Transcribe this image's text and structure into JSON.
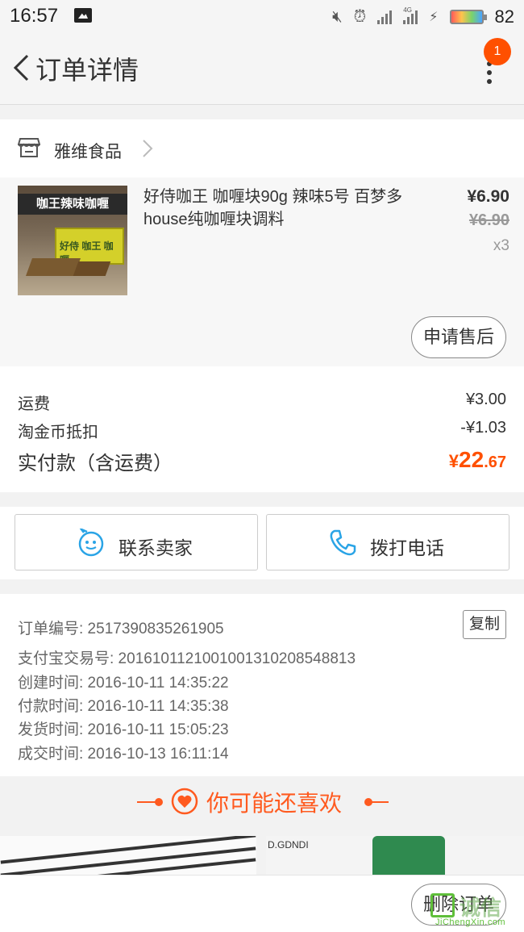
{
  "status_bar": {
    "time": "16:57",
    "network": "4G",
    "battery": "82"
  },
  "nav": {
    "title": "订单详情",
    "badge": "1"
  },
  "shop": {
    "name": "雅维食品"
  },
  "product": {
    "title": "好侍咖王 咖喱块90g 辣味5号 百梦多house纯咖喱块调料",
    "price": "¥6.90",
    "original_price": "¥6.90",
    "quantity": "x3",
    "image_banner": "咖王辣味咖喱",
    "image_box_text": "好侍 咖王 咖喱",
    "after_sale_label": "申请售后"
  },
  "fees": {
    "shipping_label": "运费",
    "shipping_value": "¥3.00",
    "coin_label": "淘金币抵扣",
    "coin_value": "-¥1.03",
    "total_label": "实付款（含运费）",
    "total_currency": "¥",
    "total_integer": "22",
    "total_decimal": ".67"
  },
  "contact": {
    "seller_label": "联系卖家",
    "phone_label": "拨打电话"
  },
  "order_info": {
    "order_no": "订单编号: 2517390835261905",
    "copy_label": "复制",
    "alipay_no": "支付宝交易号: 2016101121001001310208548813",
    "created": "创建时间: 2016-10-11 14:35:22",
    "paid": "付款时间: 2016-10-11 14:35:38",
    "shipped": "发货时间: 2016-10-11 15:05:23",
    "completed": "成交时间: 2016-10-13 16:11:14"
  },
  "recommend": {
    "title": "你可能还喜欢",
    "brand_text": "D.GDNDI"
  },
  "bottom": {
    "delete_label": "删除订单",
    "watermark_cn": "诚信",
    "watermark_en": "JiChengXin.com"
  },
  "colors": {
    "accent": "#ff5000",
    "recommend": "#ff5a1f",
    "icon_blue": "#2aa4e6"
  },
  "icons": [
    "back-icon",
    "more-icon",
    "shop-icon",
    "chevron-right-icon",
    "chat-icon",
    "phone-icon",
    "heart-icon"
  ]
}
